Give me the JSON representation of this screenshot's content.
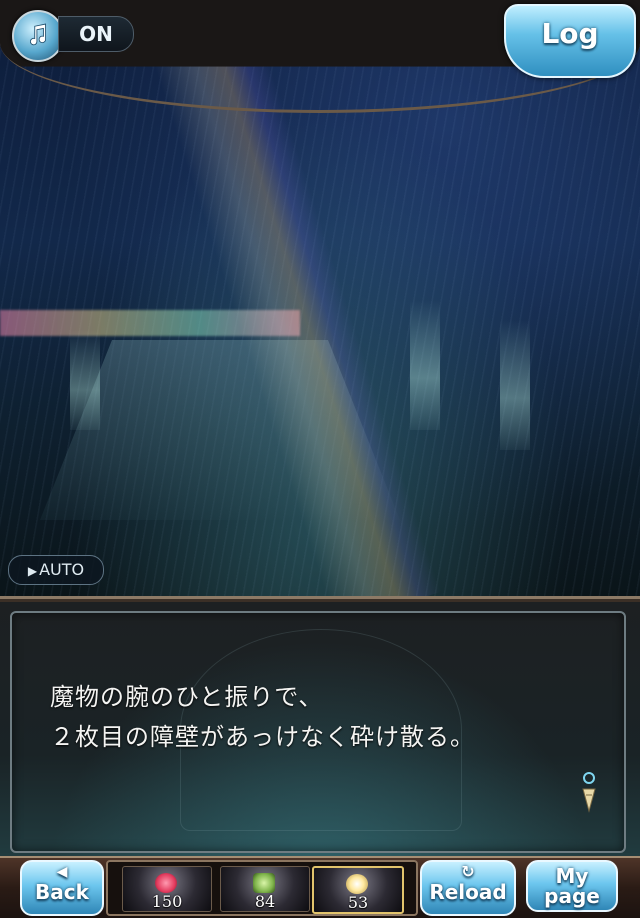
{
  "top_bar": {
    "sound_state": "ON",
    "log_label": "Log"
  },
  "scene": {
    "auto_label": "AUTO"
  },
  "dialog": {
    "lines": [
      "魔物の腕のひと振りで、",
      "２枚目の障壁があっけなく砕け散る。"
    ]
  },
  "bottom_nav": {
    "back_label": "Back",
    "reload_label": "Reload",
    "mypage_line1": "My",
    "mypage_line2": "page",
    "items": [
      {
        "count": "150",
        "icon": "red-gem-icon"
      },
      {
        "count": "84",
        "icon": "green-potion-icon"
      },
      {
        "count": "53",
        "icon": "light-orb-icon"
      }
    ]
  },
  "colors": {
    "button_blue": "#6cc6ee",
    "frame_brown": "#8d7a66",
    "text": "#f4f4f2"
  }
}
